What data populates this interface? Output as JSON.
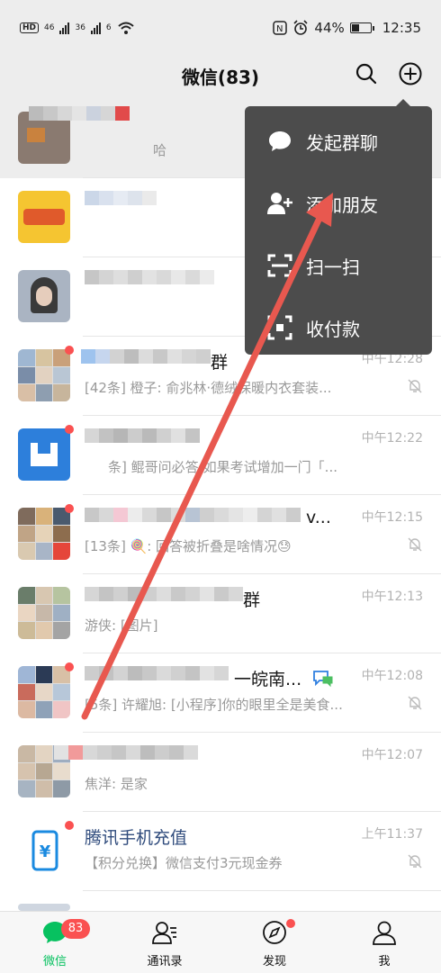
{
  "status_bar": {
    "net1": "46",
    "net2": "36",
    "net3": "6",
    "battery": "44%",
    "battery_level": 0.44,
    "time": "12:35"
  },
  "header": {
    "title": "微信(83)",
    "icons": [
      "search-icon",
      "add-icon"
    ]
  },
  "popup_menu": {
    "items": [
      {
        "label": "发起群聊",
        "icon": "chat-bubble-icon"
      },
      {
        "label": "添加朋友",
        "icon": "add-friend-icon"
      },
      {
        "label": "扫一扫",
        "icon": "scan-icon"
      },
      {
        "label": "收付款",
        "icon": "payment-icon"
      }
    ]
  },
  "chats": [
    {
      "name": "",
      "message": "哈",
      "time": ""
    },
    {
      "name": "",
      "message": "",
      "time": ""
    },
    {
      "name": "",
      "message": "",
      "time": ""
    },
    {
      "name": "群",
      "message": "[42条] 橙子: 俞兆林·德绒保暖内衣套装...",
      "time": "中午12:28"
    },
    {
      "name": "",
      "message": "条] 鲲哥问必答:如果考试增加一门「...",
      "time": "中午12:22"
    },
    {
      "name": "v...",
      "message": "[13条] 🍭: 回答被折叠是啥情况😓",
      "time": "中午12:15"
    },
    {
      "name": "群",
      "message": "游侠: [图片]",
      "time": "中午12:13"
    },
    {
      "name": "一皖南...",
      "message": "[5条] 许耀旭: [小程序]你的眼里全是美食...",
      "time": "中午12:08"
    },
    {
      "name": "",
      "message": "焦洋: 是家",
      "time": "中午12:07"
    },
    {
      "name": "腾讯手机充值",
      "message": "【积分兑换】微信支付3元现金券",
      "time": "上午11:37"
    }
  ],
  "tabbar": {
    "tabs": [
      {
        "label": "微信",
        "icon": "chat-icon",
        "badge": "83"
      },
      {
        "label": "通讯录",
        "icon": "contacts-icon"
      },
      {
        "label": "发现",
        "icon": "compass-icon"
      },
      {
        "label": "我",
        "icon": "profile-icon"
      }
    ]
  },
  "colors": {
    "accent": "#07c160",
    "badge": "#fa5151",
    "menu_bg": "#4c4c4c",
    "header_bg": "#ededed",
    "annotation_arrow": "#e8584f"
  }
}
